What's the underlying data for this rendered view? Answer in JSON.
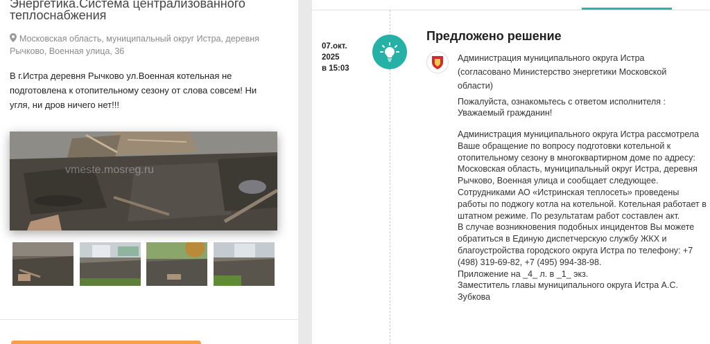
{
  "left": {
    "category": "Энергетика.Система централизованного теплоснабжения",
    "pin_icon": "map-pin-icon",
    "address": "Московская область, муниципальный округ Истра, деревня Рычково, Военная улица, 36",
    "description": "В г.Истра деревня Рычково ул.Военная котельная не подготовлена к отопительному сезону от слова совсем! Ни угля, ни дров ничего нет!!!",
    "watermark": "vmeste.mosreg.ru",
    "thumbnails": [
      {
        "name": "photo-thumbnail-1"
      },
      {
        "name": "photo-thumbnail-2"
      },
      {
        "name": "photo-thumbnail-3"
      },
      {
        "name": "photo-thumbnail-4"
      }
    ]
  },
  "event": {
    "date_line1": "07.окт.",
    "date_line2": "2025",
    "date_line3": "в 15:03",
    "icon": "lightbulb-icon",
    "title": "Предложено решение",
    "org_logo": "moscow-region-coat-of-arms-icon",
    "org_name": "Администрация муниципального округа Истра (согласовано Министерство энергетики Московской области)",
    "notice_line1": "Пожалуйста, ознакомьтесь с ответом исполнителя :",
    "notice_line2": "Уважаемый гражданин!",
    "paragraphs": [
      "Администрация муниципального округа Истра рассмотрела Ваше обращение по вопросу подготовки котельной к отопительному сезону в многоквартирном доме по адресу: Московская область, муниципальный округ Истра, деревня Рычково, Военная улица и сообщает следующее.",
      "Сотрудниками АО «Истринская теплосеть» проведены работы по поджогу котла на котельной. Котельная работает в штатном режиме. По результатам работ составлен акт.",
      "В случае возникновения подобных инцидентов Вы можете обратиться в Единую диспетчерскую службу ЖКХ и благоустройства городского округа Истра по телефону: +7 (498) 319-69-82, +7 (495) 994-38-98.",
      "Приложение на _4_ л. в _1_ экз.",
      "Заместитель главы муниципального округа Истра А.С. Зубкова"
    ]
  },
  "colors": {
    "accent_teal": "#25b1a6",
    "accent_orange": "#f6a04d",
    "background_gray": "#e9e9e9"
  }
}
